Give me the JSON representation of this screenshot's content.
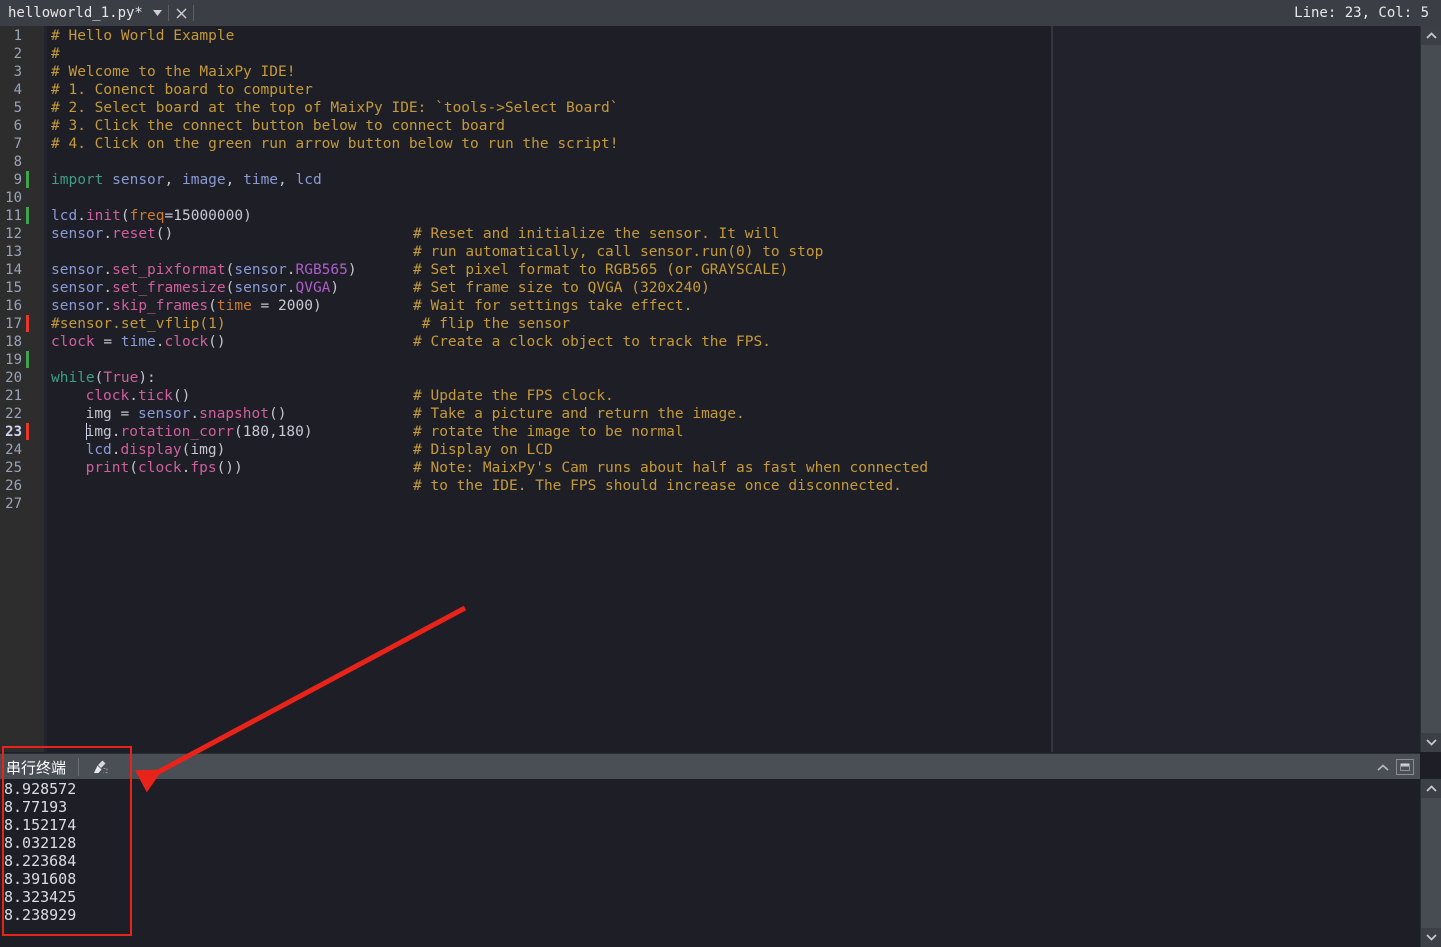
{
  "window": {
    "tab": {
      "title": "helloworld_1.py*",
      "dropdown_icon": "chevron-down-icon",
      "close_icon": "close-icon"
    },
    "status": {
      "linecol": "Line: 23, Col: 5"
    }
  },
  "editor": {
    "current_line": 23,
    "lines": [
      {
        "n": 1,
        "marker": "",
        "fold": "",
        "indent": 0,
        "code": [
          {
            "t": "# Hello World Example",
            "c": "cmt"
          }
        ],
        "comment": ""
      },
      {
        "n": 2,
        "marker": "",
        "fold": "",
        "indent": 0,
        "code": [
          {
            "t": "#",
            "c": "cmt"
          }
        ],
        "comment": ""
      },
      {
        "n": 3,
        "marker": "",
        "fold": "",
        "indent": 0,
        "code": [
          {
            "t": "# Welcome to the MaixPy IDE!",
            "c": "cmt"
          }
        ],
        "comment": ""
      },
      {
        "n": 4,
        "marker": "",
        "fold": "",
        "indent": 0,
        "code": [
          {
            "t": "# 1. Conenct board to computer",
            "c": "cmt"
          }
        ],
        "comment": ""
      },
      {
        "n": 5,
        "marker": "",
        "fold": "",
        "indent": 0,
        "code": [
          {
            "t": "# 2. Select board at the top of MaixPy IDE: `tools->Select Board`",
            "c": "cmt"
          }
        ],
        "comment": ""
      },
      {
        "n": 6,
        "marker": "",
        "fold": "",
        "indent": 0,
        "code": [
          {
            "t": "# 3. Click the connect button below to connect board",
            "c": "cmt"
          }
        ],
        "comment": ""
      },
      {
        "n": 7,
        "marker": "",
        "fold": "",
        "indent": 0,
        "code": [
          {
            "t": "# 4. Click on the green run arrow button below to run the script!",
            "c": "cmt"
          }
        ],
        "comment": ""
      },
      {
        "n": 8,
        "marker": "",
        "fold": "",
        "indent": 0,
        "code": [],
        "comment": ""
      },
      {
        "n": 9,
        "marker": "green",
        "fold": "",
        "indent": 0,
        "code": [
          {
            "t": "import",
            "c": "kw"
          },
          {
            "t": " ",
            "c": "pl"
          },
          {
            "t": "sensor",
            "c": "mod"
          },
          {
            "t": ", ",
            "c": "pl"
          },
          {
            "t": "image",
            "c": "mod"
          },
          {
            "t": ", ",
            "c": "pl"
          },
          {
            "t": "time",
            "c": "mod"
          },
          {
            "t": ", ",
            "c": "pl"
          },
          {
            "t": "lcd",
            "c": "mod"
          }
        ],
        "comment": ""
      },
      {
        "n": 10,
        "marker": "",
        "fold": "",
        "indent": 0,
        "code": [],
        "comment": ""
      },
      {
        "n": 11,
        "marker": "green",
        "fold": "",
        "indent": 0,
        "code": [
          {
            "t": "lcd",
            "c": "mod"
          },
          {
            "t": ".",
            "c": "pl"
          },
          {
            "t": "init",
            "c": "fn"
          },
          {
            "t": "(",
            "c": "pl"
          },
          {
            "t": "freq",
            "c": "arg"
          },
          {
            "t": "=",
            "c": "pl"
          },
          {
            "t": "15000000",
            "c": "num"
          },
          {
            "t": ")",
            "c": "pl"
          }
        ],
        "comment": ""
      },
      {
        "n": 12,
        "marker": "",
        "fold": "v",
        "indent": 0,
        "code": [
          {
            "t": "sensor",
            "c": "mod"
          },
          {
            "t": ".",
            "c": "pl"
          },
          {
            "t": "reset",
            "c": "fn"
          },
          {
            "t": "()",
            "c": "pl"
          }
        ],
        "comment": "# Reset and initialize the sensor. It will"
      },
      {
        "n": 13,
        "marker": "",
        "fold": "",
        "indent": 0,
        "code": [],
        "comment": "# run automatically, call sensor.run(0) to stop"
      },
      {
        "n": 14,
        "marker": "",
        "fold": "",
        "indent": 0,
        "code": [
          {
            "t": "sensor",
            "c": "mod"
          },
          {
            "t": ".",
            "c": "pl"
          },
          {
            "t": "set_pixformat",
            "c": "fn"
          },
          {
            "t": "(",
            "c": "pl"
          },
          {
            "t": "sensor",
            "c": "mod"
          },
          {
            "t": ".",
            "c": "pl"
          },
          {
            "t": "RGB565",
            "c": "cls"
          },
          {
            "t": ")",
            "c": "pl"
          }
        ],
        "comment": "# Set pixel format to RGB565 (or GRAYSCALE)"
      },
      {
        "n": 15,
        "marker": "",
        "fold": "",
        "indent": 0,
        "code": [
          {
            "t": "sensor",
            "c": "mod"
          },
          {
            "t": ".",
            "c": "pl"
          },
          {
            "t": "set_framesize",
            "c": "fn"
          },
          {
            "t": "(",
            "c": "pl"
          },
          {
            "t": "sensor",
            "c": "mod"
          },
          {
            "t": ".",
            "c": "pl"
          },
          {
            "t": "QVGA",
            "c": "cls"
          },
          {
            "t": ")",
            "c": "pl"
          }
        ],
        "comment": "# Set frame size to QVGA (320x240)"
      },
      {
        "n": 16,
        "marker": "",
        "fold": "",
        "indent": 0,
        "code": [
          {
            "t": "sensor",
            "c": "mod"
          },
          {
            "t": ".",
            "c": "pl"
          },
          {
            "t": "skip_frames",
            "c": "fn"
          },
          {
            "t": "(",
            "c": "pl"
          },
          {
            "t": "time",
            "c": "arg"
          },
          {
            "t": " = ",
            "c": "pl"
          },
          {
            "t": "2000",
            "c": "num"
          },
          {
            "t": ")",
            "c": "pl"
          }
        ],
        "comment": "# Wait for settings take effect."
      },
      {
        "n": 17,
        "marker": "red",
        "fold": "",
        "indent": 0,
        "code": [
          {
            "t": "#sensor.set_vflip(1)",
            "c": "cmt"
          }
        ],
        "comment": " # flip the sensor"
      },
      {
        "n": 18,
        "marker": "",
        "fold": "",
        "indent": 0,
        "code": [
          {
            "t": "clock",
            "c": "fn"
          },
          {
            "t": " = ",
            "c": "pl"
          },
          {
            "t": "time",
            "c": "mod"
          },
          {
            "t": ".",
            "c": "pl"
          },
          {
            "t": "clock",
            "c": "fn"
          },
          {
            "t": "()",
            "c": "pl"
          }
        ],
        "comment": "# Create a clock object to track the FPS."
      },
      {
        "n": 19,
        "marker": "green",
        "fold": "",
        "indent": 0,
        "code": [],
        "comment": ""
      },
      {
        "n": 20,
        "marker": "",
        "fold": "v",
        "indent": 0,
        "code": [
          {
            "t": "while",
            "c": "kw"
          },
          {
            "t": "(",
            "c": "pl"
          },
          {
            "t": "True",
            "c": "bool"
          },
          {
            "t": "):",
            "c": "pl"
          }
        ],
        "comment": ""
      },
      {
        "n": 21,
        "marker": "",
        "fold": "",
        "indent": 1,
        "code": [
          {
            "t": "clock",
            "c": "fn"
          },
          {
            "t": ".",
            "c": "pl"
          },
          {
            "t": "tick",
            "c": "fn"
          },
          {
            "t": "()",
            "c": "pl"
          }
        ],
        "comment": "# Update the FPS clock."
      },
      {
        "n": 22,
        "marker": "",
        "fold": "",
        "indent": 1,
        "code": [
          {
            "t": "img",
            "c": "pl"
          },
          {
            "t": " = ",
            "c": "pl"
          },
          {
            "t": "sensor",
            "c": "mod"
          },
          {
            "t": ".",
            "c": "pl"
          },
          {
            "t": "snapshot",
            "c": "fn"
          },
          {
            "t": "()",
            "c": "pl"
          }
        ],
        "comment": "# Take a picture and return the image."
      },
      {
        "n": 23,
        "marker": "red",
        "fold": "",
        "indent": 1,
        "code": [
          {
            "t": "img",
            "c": "pl"
          },
          {
            "t": ".",
            "c": "pl"
          },
          {
            "t": "rotation_corr",
            "c": "fn"
          },
          {
            "t": "(",
            "c": "pl"
          },
          {
            "t": "180",
            "c": "num"
          },
          {
            "t": ",",
            "c": "pl"
          },
          {
            "t": "180",
            "c": "num"
          },
          {
            "t": ")",
            "c": "pl"
          }
        ],
        "comment": "# rotate the image to be normal"
      },
      {
        "n": 24,
        "marker": "",
        "fold": "",
        "indent": 1,
        "code": [
          {
            "t": "lcd",
            "c": "mod"
          },
          {
            "t": ".",
            "c": "pl"
          },
          {
            "t": "display",
            "c": "fn"
          },
          {
            "t": "(",
            "c": "pl"
          },
          {
            "t": "img",
            "c": "pl"
          },
          {
            "t": ")",
            "c": "pl"
          }
        ],
        "comment": "# Display on LCD"
      },
      {
        "n": 25,
        "marker": "",
        "fold": "v",
        "indent": 1,
        "code": [
          {
            "t": "print",
            "c": "fn"
          },
          {
            "t": "(",
            "c": "pl"
          },
          {
            "t": "clock",
            "c": "fn"
          },
          {
            "t": ".",
            "c": "pl"
          },
          {
            "t": "fps",
            "c": "fn"
          },
          {
            "t": "())",
            "c": "pl"
          }
        ],
        "comment": "# Note: MaixPy's Cam runs about half as fast when connected"
      },
      {
        "n": 26,
        "marker": "",
        "fold": "",
        "indent": 0,
        "code": [],
        "comment": "# to the IDE. The FPS should increase once disconnected."
      },
      {
        "n": 27,
        "marker": "",
        "fold": "",
        "indent": 0,
        "code": [],
        "comment": ""
      }
    ]
  },
  "terminal": {
    "title": "串行终端",
    "clear_icon": "clear-broom-icon",
    "collapse_icon": "chevron-up-icon",
    "restore_icon": "restore-window-icon",
    "output": [
      "8.928572",
      "8.77193",
      "8.152174",
      "8.032128",
      "8.223684",
      "8.391608",
      "8.323425",
      "8.238929"
    ]
  },
  "scrollbars": {
    "up_icon": "chevron-up-icon",
    "down_icon": "chevron-down-icon"
  },
  "annotations": {
    "highlight_color": "#e8231a",
    "rect_label": "serial-terminal-highlight",
    "arrow_label": "pointer-arrow"
  }
}
